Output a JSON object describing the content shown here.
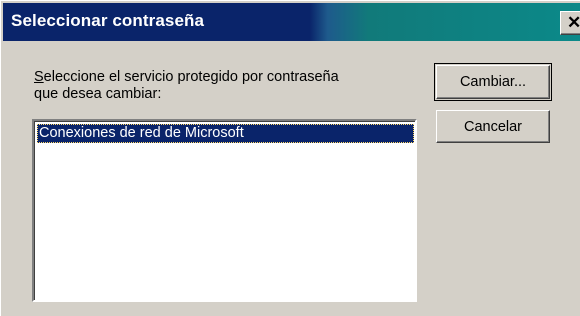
{
  "window": {
    "title": "Seleccionar contraseña",
    "close_glyph": "✕",
    "close_icon": "close-icon"
  },
  "prompt": {
    "line1": "Seleccione el servicio protegido por contraseña",
    "line2": "que desea cambiar:"
  },
  "services": {
    "items": [
      {
        "label": "Conexiones de red de Microsoft",
        "selected": true
      }
    ]
  },
  "buttons": {
    "change_label": "Cambiar...",
    "cancel_label": "Cancelar"
  },
  "colors": {
    "title_bar": "#0a246a",
    "selection": "#0a246a",
    "face": "#d4d0c8"
  }
}
